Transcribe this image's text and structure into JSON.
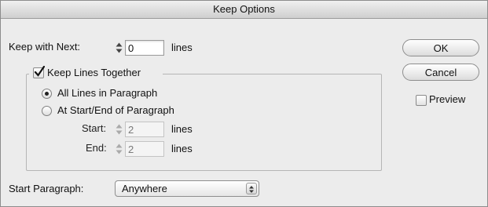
{
  "window": {
    "title": "Keep Options"
  },
  "keep_with_next": {
    "label": "Keep with Next:",
    "value": "0",
    "unit": "lines"
  },
  "keep_lines_together": {
    "label": "Keep Lines Together",
    "checked": true,
    "options": [
      {
        "label": "All Lines in Paragraph",
        "selected": true
      },
      {
        "label": "At Start/End of Paragraph",
        "selected": false
      }
    ],
    "start": {
      "label": "Start:",
      "value": "2",
      "unit": "lines"
    },
    "end": {
      "label": "End:",
      "value": "2",
      "unit": "lines"
    }
  },
  "start_paragraph": {
    "label": "Start Paragraph:",
    "value": "Anywhere"
  },
  "buttons": {
    "ok": "OK",
    "cancel": "Cancel"
  },
  "preview": {
    "label": "Preview",
    "checked": false
  }
}
